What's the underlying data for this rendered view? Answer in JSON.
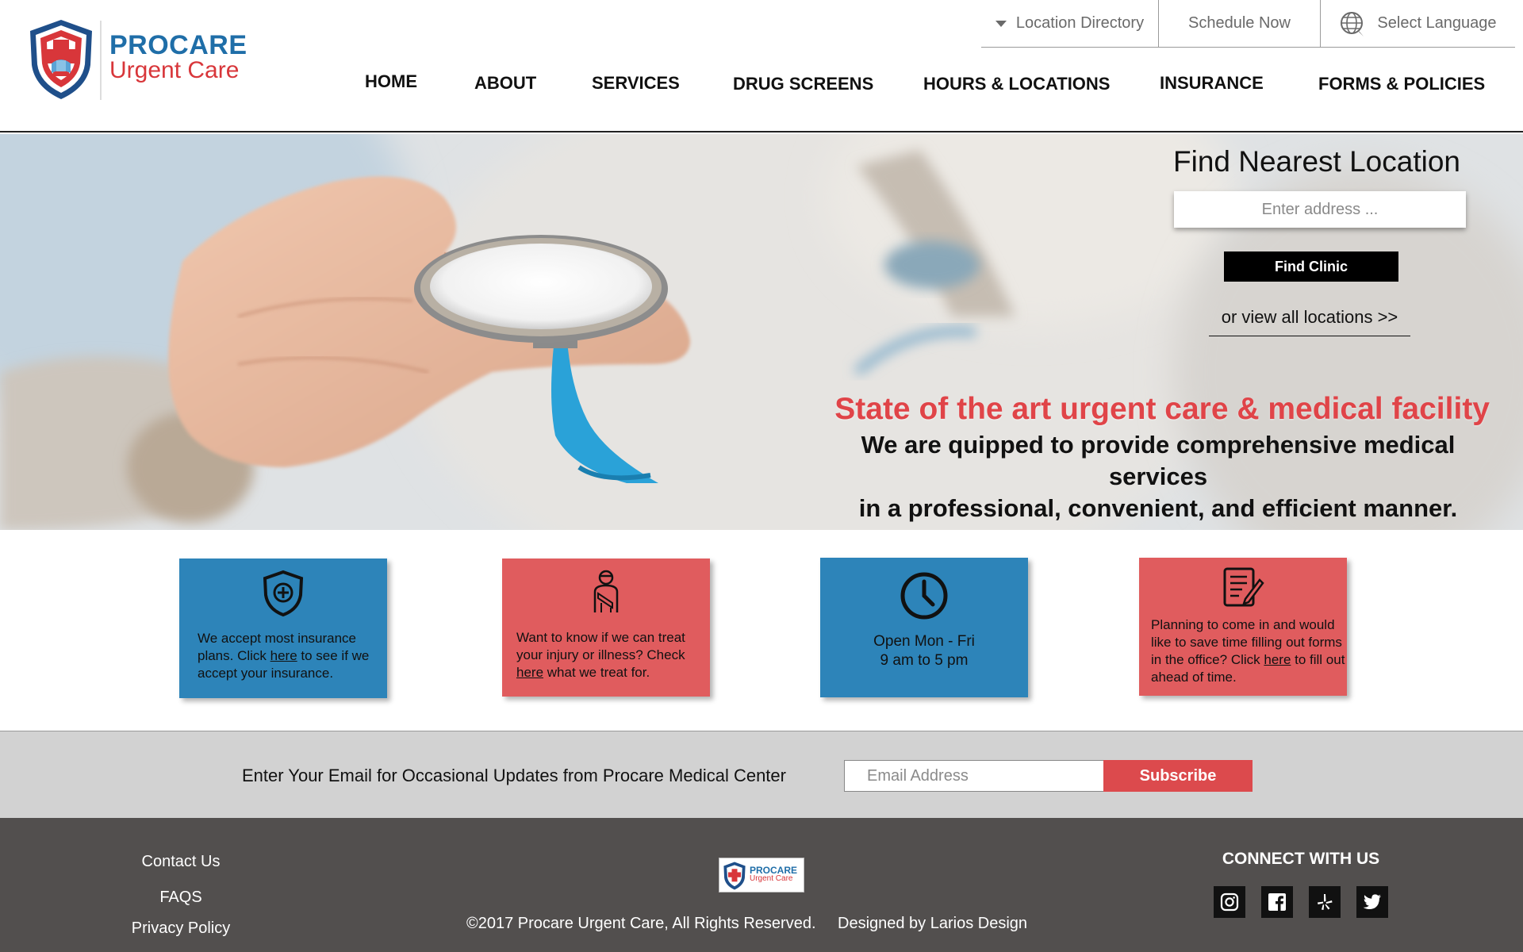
{
  "brand": {
    "name_line1": "PROCARE",
    "name_line2": "Urgent Care",
    "primary_color": "#1f6ea8",
    "accent_color": "#d8363a"
  },
  "utility_nav": {
    "location_directory": "Location Directory",
    "schedule_now": "Schedule Now",
    "select_language": "Select Language"
  },
  "main_nav": [
    {
      "label": "HOME"
    },
    {
      "label": "ABOUT"
    },
    {
      "label": "SERVICES"
    },
    {
      "label": "DRUG SCREENS"
    },
    {
      "label": "HOURS & LOCATIONS"
    },
    {
      "label": "INSURANCE"
    },
    {
      "label": "FORMS & POLICIES"
    }
  ],
  "hero": {
    "find_title": "Find Nearest Location",
    "address_placeholder": "Enter address ...",
    "find_button": "Find Clinic",
    "view_all": "or view all locations >>",
    "tagline_red": "State of the art urgent care & medical facility",
    "tagline_line1": "We are quipped to provide comprehensive medical services",
    "tagline_line2": "in a professional, convenient, and efficient manner."
  },
  "cards": [
    {
      "icon": "shield-plus-icon",
      "text_before": "We accept most insurance plans. Click ",
      "link": "here",
      "text_after": " to see if we accept your insurance.",
      "color": "#2d84b9"
    },
    {
      "icon": "injured-person-icon",
      "text_before": "Want to know if we can treat your injury or illness? Check ",
      "link": "here",
      "text_after": " what we treat for.",
      "color": "#e05c5e"
    },
    {
      "icon": "clock-icon",
      "line1": "Open Mon - Fri",
      "line2": "9 am to 5 pm",
      "color": "#2d84b9"
    },
    {
      "icon": "form-pen-icon",
      "text_before": "Planning to come in and would like to save time filling out forms in the office? Click ",
      "link": "here",
      "text_after": " to fill out ahead of time.",
      "color": "#e05c5e"
    }
  ],
  "newsletter": {
    "prompt": "Enter Your Email for Occasional Updates from Procare Medical Center",
    "email_placeholder": "Email Address",
    "subscribe": "Subscribe"
  },
  "footer": {
    "links": [
      "Contact Us",
      "FAQS",
      "Privacy Policy"
    ],
    "logo_line1": "PROCARE",
    "logo_line2": "Urgent Care",
    "copyright": "©2017 Procare Urgent Care, All Rights Reserved.",
    "designed_by": "Designed by Larios Design",
    "connect": "CONNECT WITH US",
    "social": [
      "instagram-icon",
      "facebook-icon",
      "yelp-icon",
      "twitter-icon"
    ]
  }
}
